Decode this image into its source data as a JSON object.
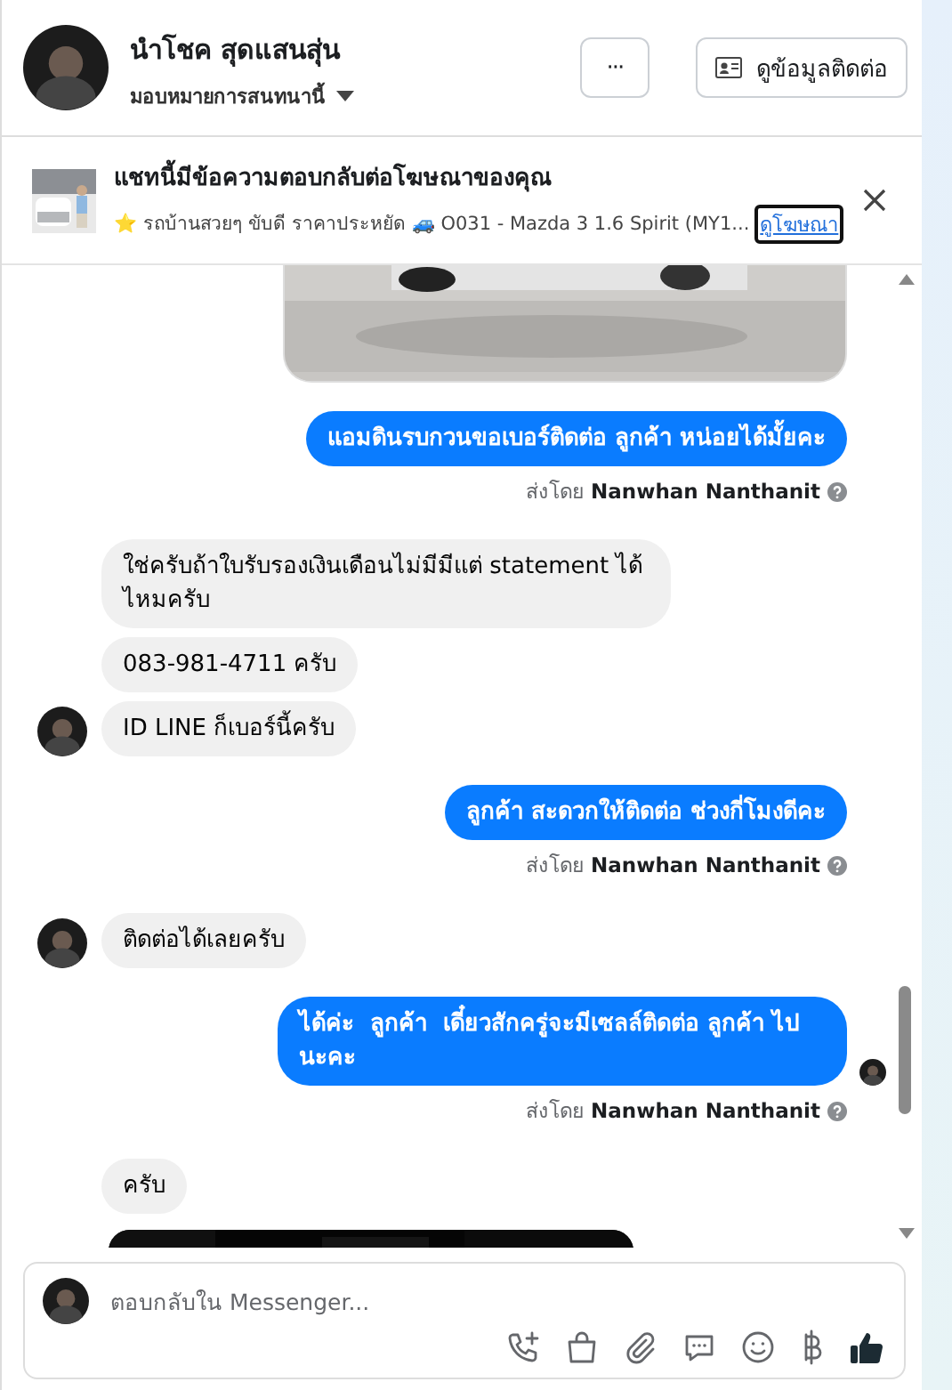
{
  "header": {
    "name": "นำโชค สุดแสนสุ่น",
    "assign": "มอบหมายการสนทนานี้",
    "more": "···",
    "contact": "ดูข้อมูลติดต่อ"
  },
  "ad_banner": {
    "title": "แชทนี้มีข้อความตอบกลับต่อโฆษณาของคุณ",
    "subtitle": "⭐ รถบ้านสวยๆ ขับดี ราคาประหยัด 🚙 O031 - Mazda 3 1.6 Spirit (MY1...",
    "link": "ดูโฆษณา"
  },
  "messages": [
    {
      "kind": "sent_image"
    },
    {
      "kind": "sent_text",
      "text": "แอมดินรบกวนขอเบอร์ติดต่อ ลูกค้า หน่อยได้มั้ยคะ",
      "seen": false
    },
    {
      "kind": "sent_by",
      "text": "ส่งโดย **Nanwhan Nanthanit**"
    },
    {
      "kind": "received_text",
      "text": "ใช่ครับถ้าใบรับรองเงินเดือนไม่มีมีแต่ statement ได้ไหมครับ",
      "avatar": false
    },
    {
      "kind": "received_text",
      "text": "083-981-4711 ครับ",
      "avatar": false
    },
    {
      "kind": "received_text",
      "text": "ID LINE ก็เบอร์นี้ครับ",
      "avatar": true
    },
    {
      "kind": "sent_text",
      "text": "ลูกค้า สะดวกให้ติดต่อ ช่วงกี่โมงดีคะ",
      "seen": false
    },
    {
      "kind": "sent_by",
      "text": "ส่งโดย **Nanwhan Nanthanit**"
    },
    {
      "kind": "received_text",
      "text": "ติดต่อได้เลยครับ",
      "avatar": true
    },
    {
      "kind": "sent_text",
      "text": "ได้ค่ะ  ลูกค้า  เดี๋ยวสักครู่จะมีเซลล์ติดต่อ ลูกค้า ไปนะคะ",
      "seen": true
    },
    {
      "kind": "sent_by",
      "text": "ส่งโดย **Nanwhan Nanthanit**"
    },
    {
      "kind": "received_text",
      "text": "ครับ",
      "avatar": false
    },
    {
      "kind": "received_image"
    }
  ],
  "composer": {
    "placeholder": "ตอบกลับใน Messenger..."
  }
}
